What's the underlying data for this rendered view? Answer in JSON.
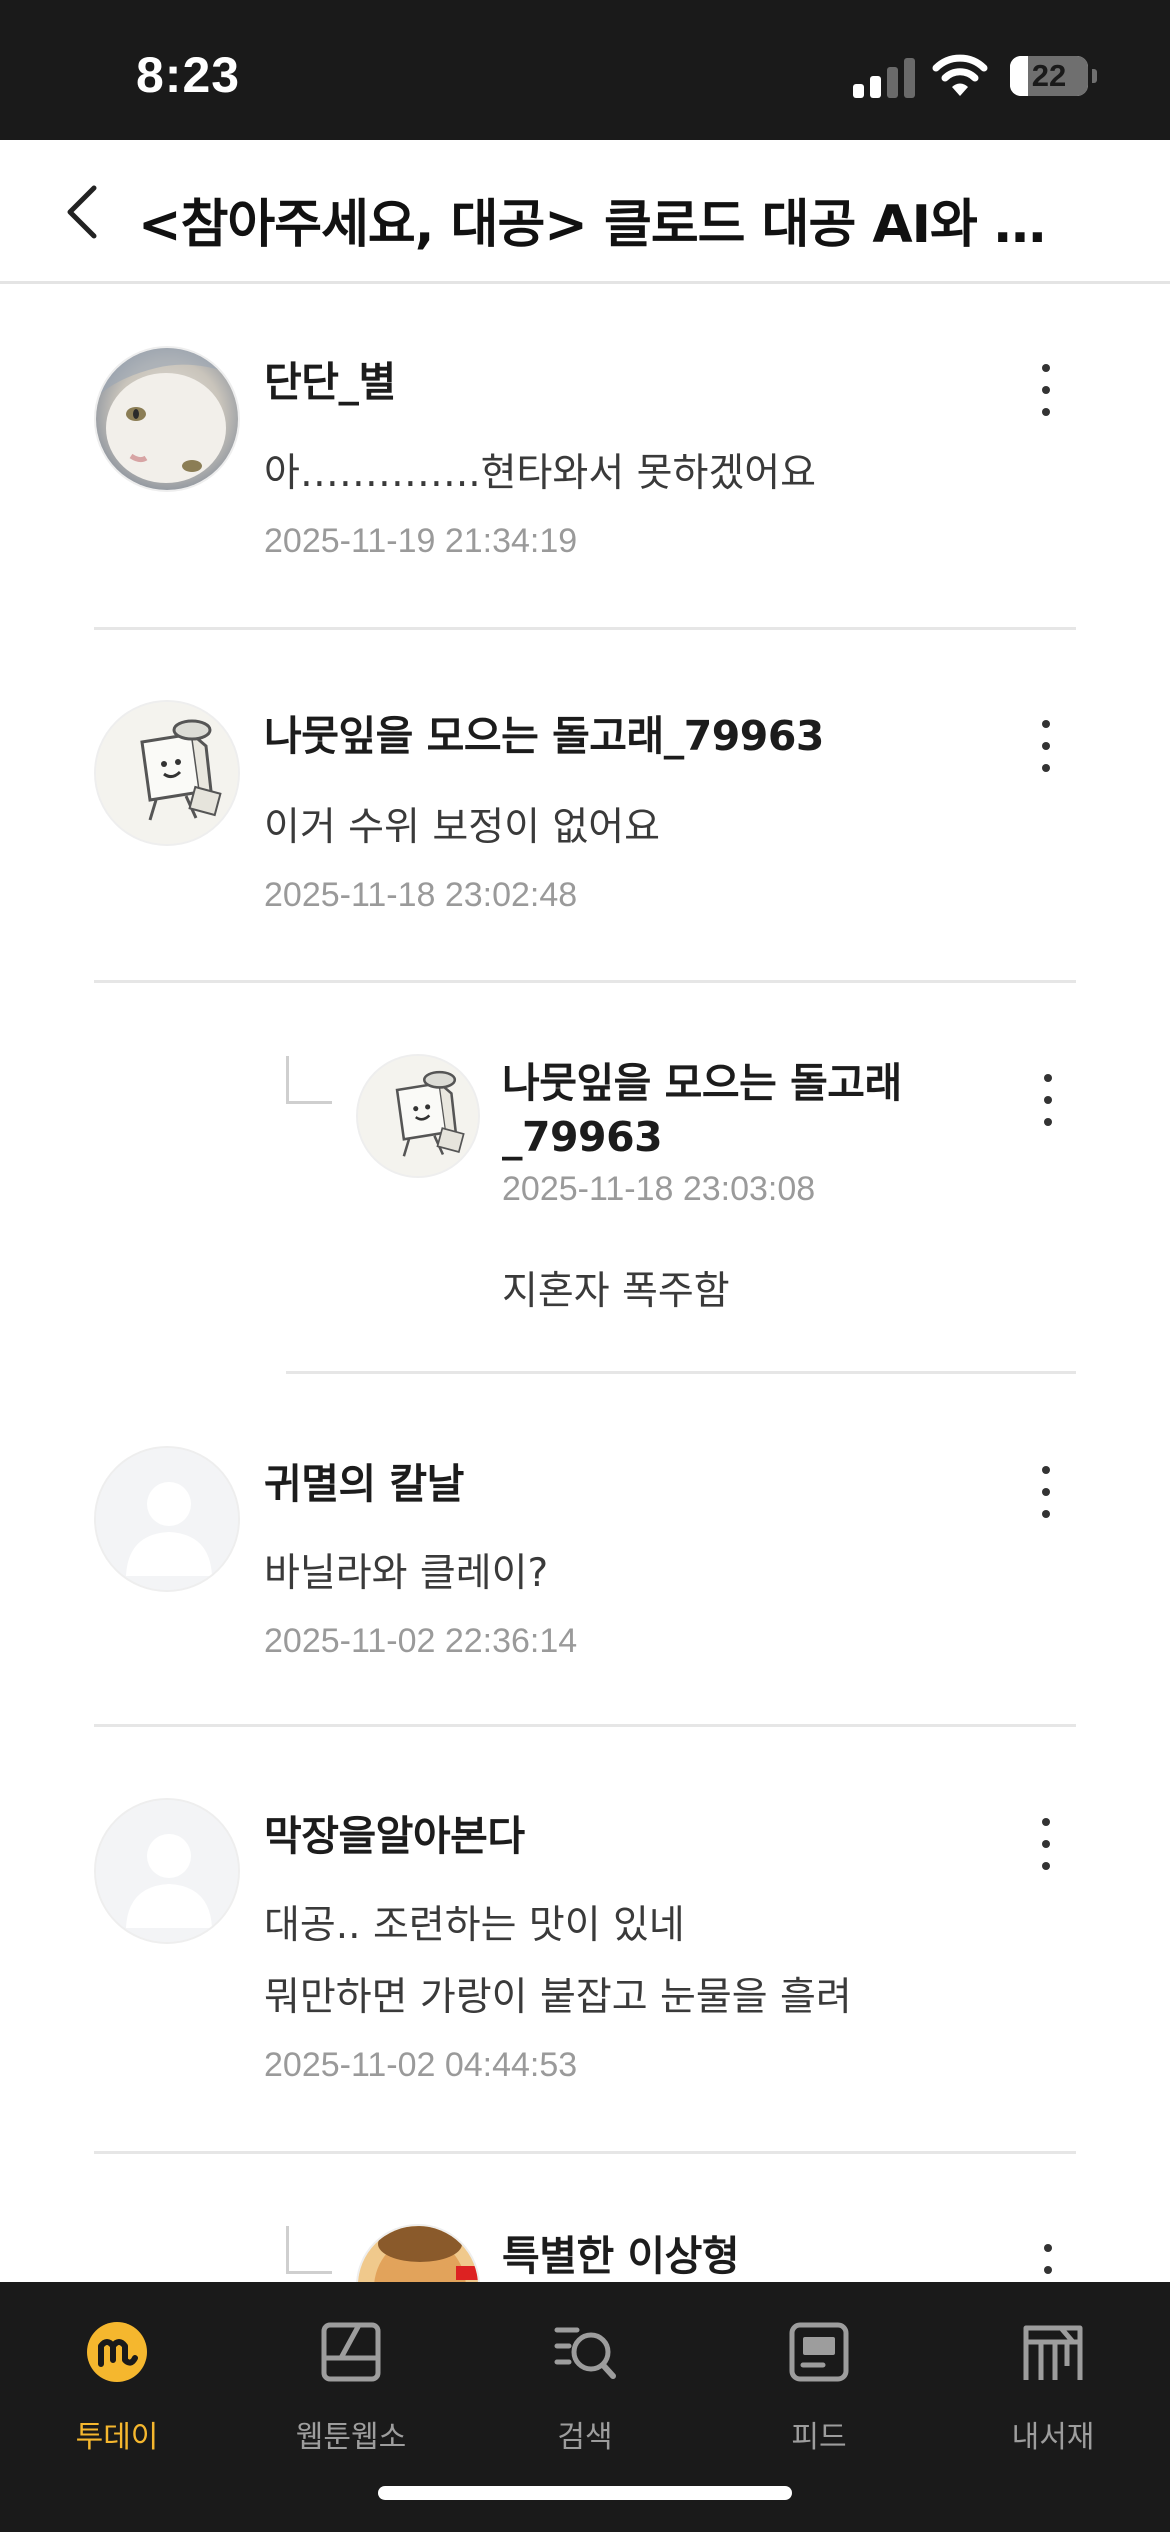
{
  "status_bar": {
    "time": "8:23",
    "battery": "22"
  },
  "header": {
    "title": "<참아주세요, 대공> 클로드 대공 AI와 심…"
  },
  "comments": [
    {
      "username": "단단_별",
      "lines": [
        "아…………..현타와서 못하겠어요"
      ],
      "timestamp": "2025-11-19 21:34:19"
    },
    {
      "username": "나뭇잎을 모으는 돌고래_79963",
      "lines": [
        "이거 수위 보정이 없어요"
      ],
      "timestamp": "2025-11-18 23:02:48"
    },
    {
      "username_line1": "나뭇잎을 모으는 돌고래",
      "username_line2": "_79963",
      "lines": [
        "지혼자 폭주함"
      ],
      "timestamp": "2025-11-18 23:03:08",
      "is_reply": true
    },
    {
      "username": "귀멸의 칼날",
      "lines": [
        "바닐라와 클레이?"
      ],
      "timestamp": "2025-11-02 22:36:14"
    },
    {
      "username": "막장을알아본다",
      "lines": [
        "대공.. 조련하는 맛이 있네",
        "뭐만하면 가랑이 붙잡고 눈물을 흘려"
      ],
      "timestamp": "2025-11-02 04:44:53"
    },
    {
      "username": "특별한 이상형",
      "is_reply": true
    }
  ],
  "bottom_nav": [
    {
      "label": "투데이",
      "icon": "today-m-icon",
      "active": true
    },
    {
      "label": "웹툰웹소",
      "icon": "webtoon-icon",
      "active": false
    },
    {
      "label": "검색",
      "icon": "search-icon",
      "active": false
    },
    {
      "label": "피드",
      "icon": "feed-icon",
      "active": false
    },
    {
      "label": "내서재",
      "icon": "library-icon",
      "active": false
    }
  ],
  "colors": {
    "accent": "#f5b72e",
    "dark_bg": "#1a1a1a",
    "timestamp": "#9a9a9a",
    "divider": "#e6e6e6"
  }
}
